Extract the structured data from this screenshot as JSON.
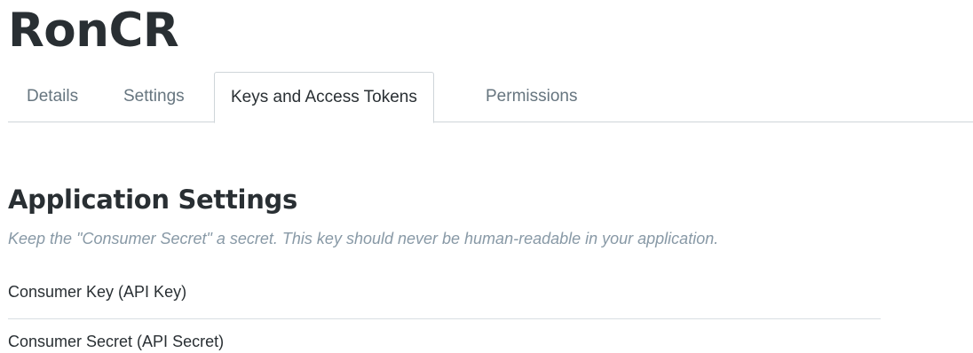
{
  "app": {
    "title": "RonCR"
  },
  "tabs": [
    {
      "label": "Details",
      "active": false
    },
    {
      "label": "Settings",
      "active": false
    },
    {
      "label": "Keys and Access Tokens",
      "active": true
    },
    {
      "label": "Permissions",
      "active": false
    }
  ],
  "application_settings": {
    "heading": "Application Settings",
    "note": "Keep the \"Consumer Secret\" a secret. This key should never be human-readable in your application.",
    "fields": [
      {
        "label": "Consumer Key (API Key)"
      },
      {
        "label": "Consumer Secret (API Secret)"
      }
    ]
  },
  "colors": {
    "heading": "#292f33",
    "tab_inactive": "#66757f",
    "note": "#8899a6",
    "border": "#cfd5d9"
  }
}
